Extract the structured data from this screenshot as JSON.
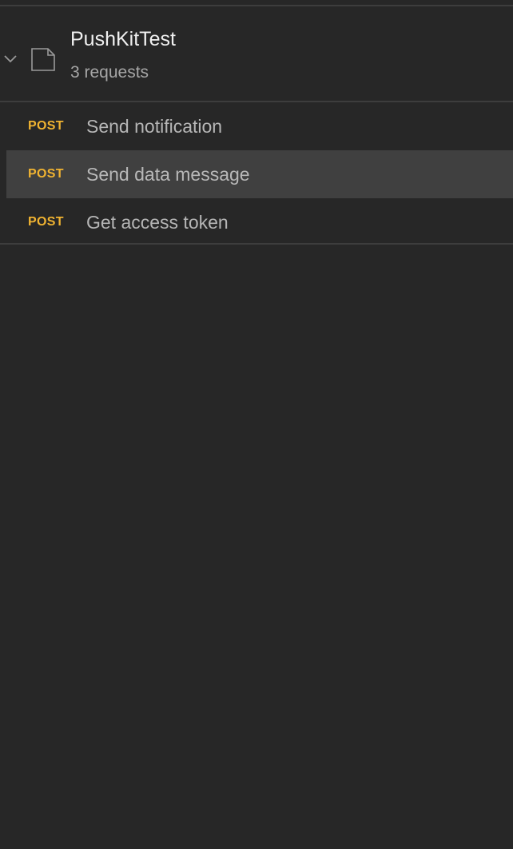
{
  "collection": {
    "name": "PushKitTest",
    "count": "3 requests",
    "expanded_icon": "chevron-down-icon",
    "folder_icon": "collection-folder-icon"
  },
  "requests": [
    {
      "method": "POST",
      "name": "Send notification",
      "selected": false
    },
    {
      "method": "POST",
      "name": "Send data message",
      "selected": true
    },
    {
      "method": "POST",
      "name": "Get access token",
      "selected": false
    }
  ],
  "colors": {
    "background": "#272727",
    "selected_row": "#404040",
    "method_post": "#f0b331",
    "divider": "#3d3d3d"
  }
}
